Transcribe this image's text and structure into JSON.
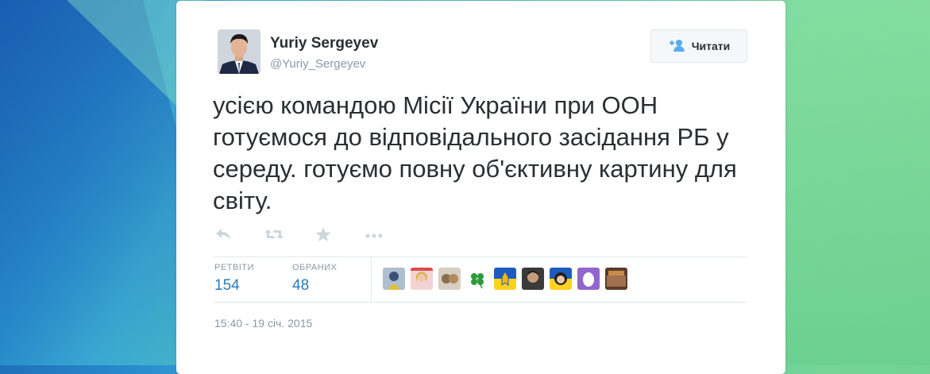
{
  "tweet": {
    "author_name": "Yuriy Sergeyev",
    "author_handle": "@Yuriy_Sergeyev",
    "follow_label": "Читати",
    "text": "усією командою Місії України при ООН готуємося до відповідального засідання РБ у середу. готуємо повну об'єктивну картину для світу.",
    "retweets_label": "РЕТВІТИ",
    "retweets_count": "154",
    "favorites_label": "ОБРАНИХ",
    "favorites_count": "48",
    "timestamp": "15:40 - 19 січ. 2015"
  },
  "icons": [
    "reply-icon",
    "retweet-icon",
    "favorite-icon",
    "more-icon",
    "follow-person-icon"
  ],
  "colors": {
    "link": "#2b7bb9",
    "muted": "#8899a6",
    "text": "#292f33",
    "divider": "#e1e8ed"
  }
}
